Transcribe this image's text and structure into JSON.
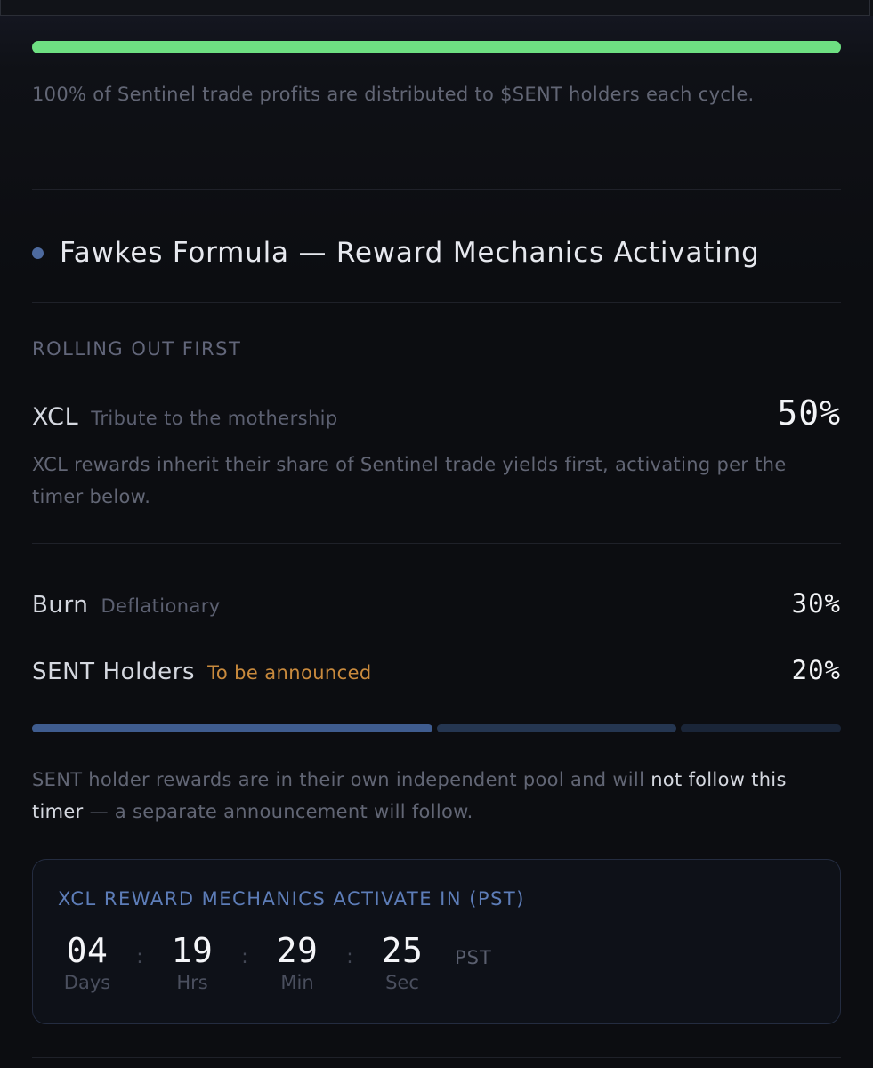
{
  "progress": {
    "value_percent": 100,
    "color": "#6ee082"
  },
  "intro": {
    "text": "100% of Sentinel trade profits are distributed to $SENT holders each cycle."
  },
  "section": {
    "title": "Fawkes Formula — Reward Mechanics Activating"
  },
  "rollout": {
    "label": "ROLLING OUT FIRST"
  },
  "allocations": [
    {
      "name": "XCL",
      "subtitle": "Tribute to the mothership",
      "percent": "50%"
    },
    {
      "name": "Burn",
      "subtitle": "Deflationary",
      "percent": "30%"
    },
    {
      "name": "SENT Holders",
      "subtitle": "To be announced",
      "percent": "20%"
    }
  ],
  "xcl_description": "XCL rewards inherit their share of Sentinel trade yields first, activating per the timer below.",
  "split_bar": [
    {
      "label": "XCL",
      "share": 0.5,
      "color": "#3f5c8f"
    },
    {
      "label": "Burn",
      "share": 0.3,
      "color": "#253651"
    },
    {
      "label": "SENT Holders",
      "share": 0.2,
      "color": "#1a2538"
    }
  ],
  "holder_note": {
    "before": "SENT holder rewards are in their own independent pool and will ",
    "highlight": "not follow this timer",
    "after": " — a separate announcement will follow."
  },
  "countdown": {
    "title": "XCL REWARD MECHANICS ACTIVATE IN (PST)",
    "units": [
      {
        "value": "04",
        "label": "Days"
      },
      {
        "value": "19",
        "label": "Hrs"
      },
      {
        "value": "29",
        "label": "Min"
      },
      {
        "value": "25",
        "label": "Sec"
      }
    ],
    "separator": ":",
    "timezone": "PST"
  }
}
